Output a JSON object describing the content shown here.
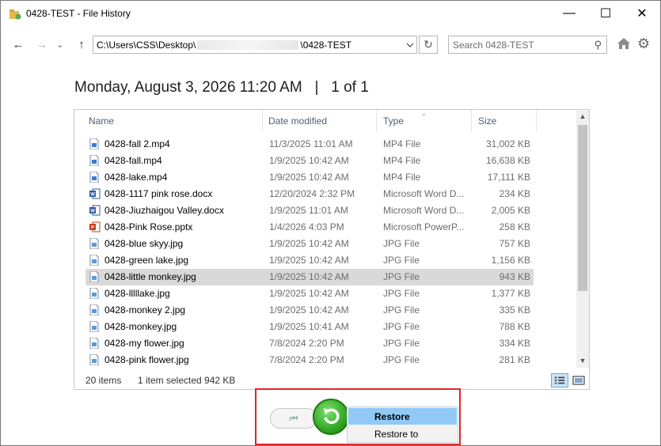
{
  "window": {
    "title": "0428-TEST - File History",
    "minimize": "—",
    "maximize": "☐",
    "close": "✕"
  },
  "nav": {
    "back": "←",
    "forward": "→",
    "recent": "⌄",
    "up": "↑",
    "address_prefix": "C:\\Users\\CSS\\Desktop\\",
    "address_suffix": "\\0428-TEST",
    "refresh": "↻",
    "search_placeholder": "Search 0428-TEST"
  },
  "snapshot": {
    "label": "Monday, August 3, 2026 11:20 AM   |   1 of 1"
  },
  "columns": {
    "name": "Name",
    "date": "Date modified",
    "type": "Type",
    "size": "Size"
  },
  "files": [
    {
      "name": "0428-fall 2.mp4",
      "date": "11/3/2025 11:01 AM",
      "type": "MP4 File",
      "size": "31,002 KB",
      "icon": "video-file-icon"
    },
    {
      "name": "0428-fall.mp4",
      "date": "1/9/2025 10:42 AM",
      "type": "MP4 File",
      "size": "16,638 KB",
      "icon": "video-file-icon"
    },
    {
      "name": "0428-lake.mp4",
      "date": "1/9/2025 10:42 AM",
      "type": "MP4 File",
      "size": "17,111 KB",
      "icon": "video-file-icon"
    },
    {
      "name": "0428-1117 pink rose.docx",
      "date": "12/20/2024 2:32 PM",
      "type": "Microsoft Word D...",
      "size": "234 KB",
      "icon": "word-file-icon"
    },
    {
      "name": "0428-Jiuzhaigou Valley.docx",
      "date": "1/9/2025 11:01 AM",
      "type": "Microsoft Word D...",
      "size": "2,005 KB",
      "icon": "word-file-icon"
    },
    {
      "name": "0428-Pink Rose.pptx",
      "date": "1/4/2026 4:03 PM",
      "type": "Microsoft PowerP...",
      "size": "258 KB",
      "icon": "powerpoint-file-icon"
    },
    {
      "name": "0428-blue skyy.jpg",
      "date": "1/9/2025 10:42 AM",
      "type": "JPG File",
      "size": "757 KB",
      "icon": "image-file-icon"
    },
    {
      "name": "0428-green lake.jpg",
      "date": "1/9/2025 10:42 AM",
      "type": "JPG File",
      "size": "1,156 KB",
      "icon": "image-file-icon"
    },
    {
      "name": "0428-little monkey.jpg",
      "date": "1/9/2025 10:42 AM",
      "type": "JPG File",
      "size": "943 KB",
      "icon": "image-file-icon",
      "selected": true
    },
    {
      "name": "0428-lllllake.jpg",
      "date": "1/9/2025 10:42 AM",
      "type": "JPG File",
      "size": "1,377 KB",
      "icon": "image-file-icon"
    },
    {
      "name": "0428-monkey 2.jpg",
      "date": "1/9/2025 10:42 AM",
      "type": "JPG File",
      "size": "335 KB",
      "icon": "image-file-icon"
    },
    {
      "name": "0428-monkey.jpg",
      "date": "1/9/2025 10:41 AM",
      "type": "JPG File",
      "size": "788 KB",
      "icon": "image-file-icon"
    },
    {
      "name": "0428-my flower.jpg",
      "date": "7/8/2024 2:20 PM",
      "type": "JPG File",
      "size": "334 KB",
      "icon": "image-file-icon"
    },
    {
      "name": "0428-pink flower.jpg",
      "date": "7/8/2024 2:20 PM",
      "type": "JPG File",
      "size": "281 KB",
      "icon": "image-file-icon"
    }
  ],
  "status": {
    "count": "20 items",
    "selection": "1 item selected  942 KB"
  },
  "controls": {
    "previous": "⏮",
    "menu_restore": "Restore",
    "menu_restore_to": "Restore to"
  },
  "colors": {
    "highlight_border": "#e0262b",
    "menu_hover": "#91c9f7",
    "restore_green": "#2a9c1b"
  }
}
